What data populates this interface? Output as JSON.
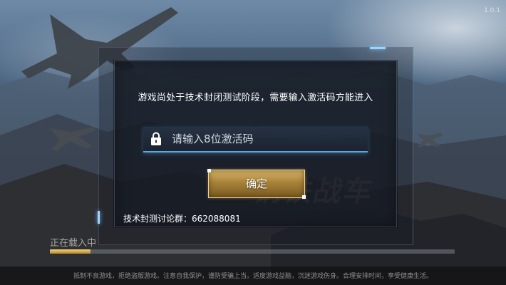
{
  "corner_label": "1.0.1",
  "dialog": {
    "message": "游戏尚处于技术封闭测试阶段，需要输入激活码方能进入",
    "code_input": {
      "placeholder": "请输入8位激活码",
      "value": ""
    },
    "confirm_label": "确定",
    "group_text": "技术封测讨论群：662088081"
  },
  "background_title": "钢铁战车",
  "loading": {
    "label": "正在载入中",
    "progress": 0.1
  },
  "notice": "抵制不良游戏，拒绝盗版游戏。注意自我保护，谨防受骗上当。适度游戏益脑，沉迷游戏伤身。合理安排时间，享受健康生活。",
  "colors": {
    "accent_blue": "#5aa9e6",
    "button_gold": "#a88238",
    "progress_gold": "#f3d27a"
  },
  "icons": {
    "lock": "lock-icon"
  }
}
